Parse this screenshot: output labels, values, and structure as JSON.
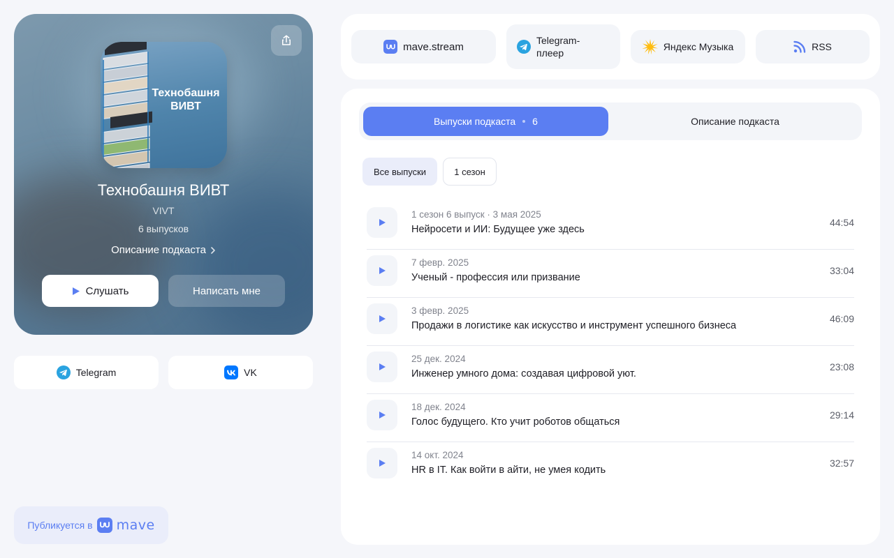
{
  "podcast": {
    "title": "Технобашня ВИВТ",
    "author": "VIVT",
    "episode_count": "6 выпусков",
    "description_link": "Описание подкаста",
    "cover_title": "Технобашня ВИВТ",
    "listen_label": "Слушать",
    "write_label": "Написать мне"
  },
  "socials": [
    {
      "label": "Telegram",
      "icon": "telegram-icon"
    },
    {
      "label": "VK",
      "icon": "vk-icon"
    }
  ],
  "published": {
    "prefix": "Публикуется в",
    "brand": "mave"
  },
  "platforms": [
    {
      "label": "mave.stream",
      "icon": "mave-icon"
    },
    {
      "label_line1": "Telegram-",
      "label_line2": "плеер",
      "icon": "telegram-icon"
    },
    {
      "label": "Яндекс Музыка",
      "icon": "yandex-music-icon"
    },
    {
      "label": "RSS",
      "icon": "rss-icon"
    }
  ],
  "tabs": {
    "episodes_label": "Выпуски подкаста",
    "episodes_count": "6",
    "description_label": "Описание подкаста"
  },
  "filters": {
    "all": "Все выпуски",
    "season": "1 сезон"
  },
  "episodes": [
    {
      "meta": "1 сезон 6 выпуск · 3 мая 2025",
      "title": "Нейросети и ИИ: Будущее уже здесь",
      "duration": "44:54"
    },
    {
      "meta": "7 февр. 2025",
      "title": "Ученый - профессия или призвание",
      "duration": "33:04"
    },
    {
      "meta": "3 февр. 2025",
      "title": "Продажи в логистике как искусство и инструмент успешного бизнеса",
      "duration": "46:09"
    },
    {
      "meta": "25 дек. 2024",
      "title": "Инженер умного дома: создавая цифровой уют.",
      "duration": "23:08"
    },
    {
      "meta": "18 дек. 2024",
      "title": "Голос будущего. Кто учит роботов общаться",
      "duration": "29:14"
    },
    {
      "meta": "14 окт. 2024",
      "title": "HR в IT. Как войти в айти, не умея кодить",
      "duration": "32:57"
    }
  ],
  "colors": {
    "accent": "#5b7ef2",
    "background": "#f5f6fa",
    "card": "#ffffff"
  }
}
